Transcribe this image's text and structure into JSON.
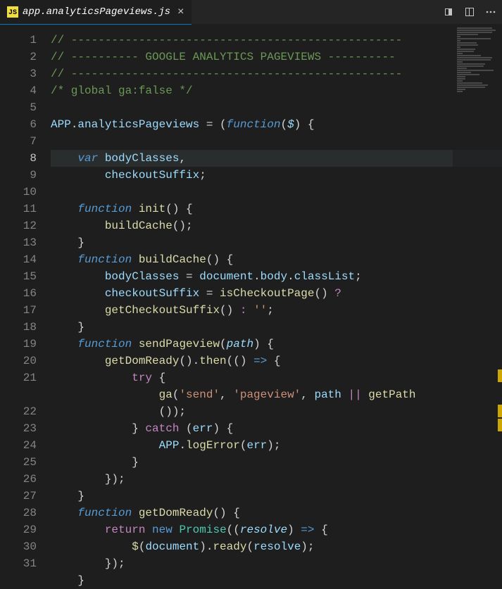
{
  "tab": {
    "filename": "app.analyticsPageviews.js",
    "icon_label": "JS"
  },
  "gutter": {
    "current_line": 8,
    "lines": [
      "1",
      "2",
      "3",
      "4",
      "5",
      "6",
      "7",
      "8",
      "9",
      "10",
      "11",
      "12",
      "13",
      "14",
      "15",
      "16",
      "17",
      "18",
      "19",
      "20",
      "21",
      "",
      "22",
      "23",
      "24",
      "25",
      "26",
      "27",
      "28",
      "29",
      "30",
      "31"
    ]
  },
  "code": {
    "l1": "// -------------------------------------------------",
    "l2a": "// ---------- ",
    "l2b": "GOOGLE ANALYTICS PAGEVIEWS",
    "l2c": " ----------",
    "l3": "// -------------------------------------------------",
    "l4": "/* global ga:false */",
    "l6_app": "APP",
    "l6_prop": "analyticsPageviews",
    "l6_func": "function",
    "l6_param": "$",
    "l8_var": "var",
    "l8_a": "bodyClasses",
    "l9_a": "checkoutSuffix",
    "l11_kw": "function",
    "l11_name": "init",
    "l12_call": "buildCache",
    "l14_kw": "function",
    "l14_name": "buildCache",
    "l15_a": "bodyClasses",
    "l15_b": "document",
    "l15_c": "body",
    "l15_d": "classList",
    "l16_a": "checkoutSuffix",
    "l16_b": "isCheckoutPage",
    "l16b_a": "getCheckoutSuffix",
    "l16b_str": "''",
    "l18_kw": "function",
    "l18_name": "sendPageview",
    "l18_param": "path",
    "l19_a": "getDomReady",
    "l19_b": "then",
    "l20_try": "try",
    "l21_a": "ga",
    "l21_s1": "'send'",
    "l21_s2": "'pageview'",
    "l21_b": "path",
    "l21_c": "getPath",
    "l22_catch": "catch",
    "l22_err": "err",
    "l23_app": "APP",
    "l23_fn": "logError",
    "l23_arg": "err",
    "l27_kw": "function",
    "l27_name": "getDomReady",
    "l28_ret": "return",
    "l28_new": "new",
    "l28_prom": "Promise",
    "l28_param": "resolve",
    "l29_a": "$",
    "l29_b": "document",
    "l29_c": "ready",
    "l29_d": "resolve"
  }
}
